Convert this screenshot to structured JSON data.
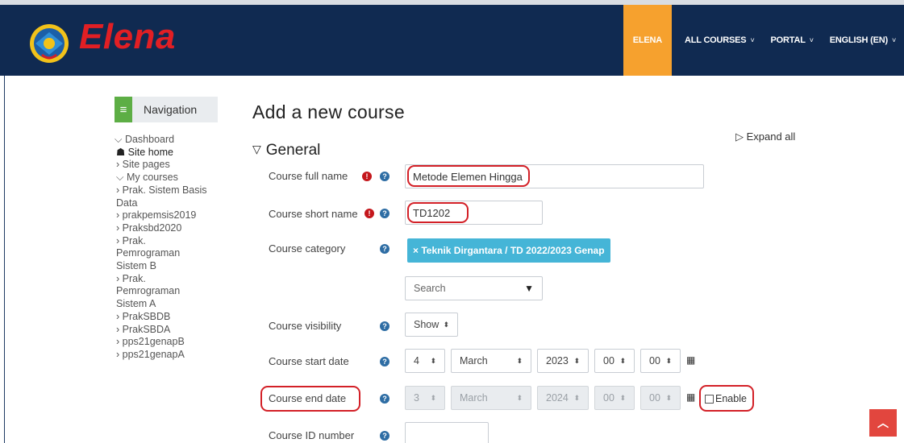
{
  "header": {
    "brand": "Elena",
    "nav": [
      {
        "label": "ELENA",
        "active": true,
        "caret": ""
      },
      {
        "label": "ALL COURSES",
        "active": false,
        "caret": "˅"
      },
      {
        "label": "PORTAL",
        "active": false,
        "caret": "˅"
      },
      {
        "label": "ENGLISH (EN)",
        "active": false,
        "caret": "˅"
      }
    ]
  },
  "navigation": {
    "title": "Navigation",
    "items": [
      {
        "label": "⌵ Dashboard"
      },
      {
        "label": "☗ Site home"
      },
      {
        "label": "› Site pages"
      },
      {
        "label": "⌵ My courses"
      },
      {
        "label": "› Prak. Sistem Basis Data"
      },
      {
        "label": "› prakpemsis2019"
      },
      {
        "label": "› Praksbd2020"
      },
      {
        "label": "› Prak. Pemrograman Sistem B"
      },
      {
        "label": "› Prak. Pemrograman Sistem A"
      },
      {
        "label": "› PrakSBDB"
      },
      {
        "label": "› PrakSBDA"
      },
      {
        "label": "› pps21genapB"
      },
      {
        "label": "› pps21genapA"
      }
    ]
  },
  "form": {
    "page_title": "Add a new course",
    "expand_all": "▷ Expand all",
    "section": "General",
    "fields": {
      "full_name": {
        "label": "Course full name",
        "value": "Metode Elemen Hingga"
      },
      "short_name": {
        "label": "Course short name",
        "value": "TD1202"
      },
      "category": {
        "label": "Course category",
        "value": "× Teknik Dirgantara / TD 2022/2023 Genap",
        "search_placeholder": "Search"
      },
      "visibility": {
        "label": "Course visibility",
        "value": "Show"
      },
      "start_date": {
        "label": "Course start date",
        "day": "4",
        "month": "March",
        "year": "2023",
        "hour": "00",
        "minute": "00"
      },
      "end_date": {
        "label": "Course end date",
        "day": "3",
        "month": "March",
        "year": "2024",
        "hour": "00",
        "minute": "00",
        "enable_label": "Enable",
        "enabled": false
      },
      "id_number": {
        "label": "Course ID number",
        "value": ""
      }
    }
  },
  "colors": {
    "topbar": "#102a51",
    "brand": "#e11f24",
    "active_nav": "#f6a12e",
    "nav_icon": "#5dae45",
    "tag": "#45b5d7",
    "annotation": "#d32027",
    "back_to_top": "#e2463e"
  }
}
